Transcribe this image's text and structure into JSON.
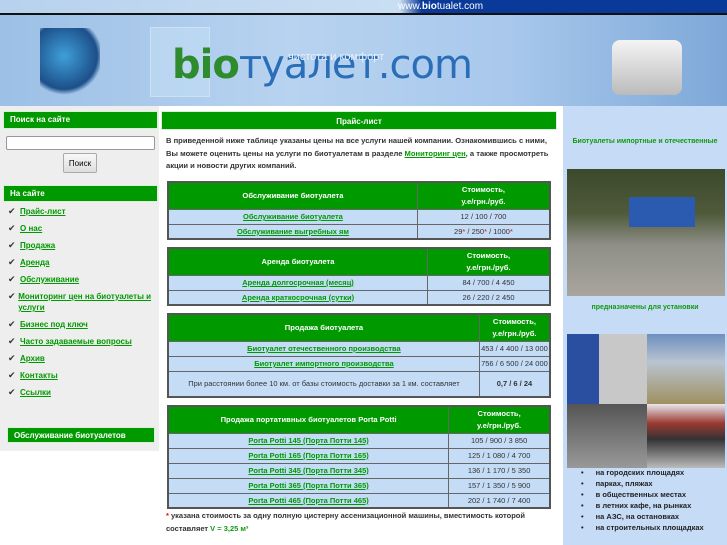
{
  "header": {
    "url_prefix": "www.",
    "url_bold": "bio",
    "url_suffix": "tualet.com",
    "logo_a": "bi",
    "logo_b": "o",
    "logo_c": "туалет.com",
    "slogan": "чистота и комфорт"
  },
  "sidebar": {
    "search_title": "Поиск на сайте",
    "search_value": "",
    "search_button": "Поиск",
    "nav_title": "На сайте",
    "items": [
      "Прайс-лист",
      "О нас",
      "Продажа",
      "Аренда",
      "Обслуживание",
      "Мониторинг цен на биотуалеты и услуги",
      "Бизнес под ключ",
      "Часто задаваемые вопросы",
      "Архив",
      "Контакты",
      "Ссылки"
    ],
    "service_title": "Обслуживание биотуалетов"
  },
  "main": {
    "title": "Прайс-лист",
    "intro_1": "В приведенной ниже таблице указаны цены на все услуги нашей компании. Ознакомившись с ними, Вы можете оценить цены на услуги по биотуалетам в разделе ",
    "intro_link": "Мониторинг цен",
    "intro_2": ", а также просмотреть акции и новости других компаний.",
    "cost_header_1": "Стоимость,",
    "cost_header_2": "у.е/грн./руб.",
    "t1": {
      "title": "Обслуживание биотуалета",
      "rows": [
        {
          "name": "Обслуживание биотуалета",
          "v": "12 / 100 / 700"
        },
        {
          "name": "Обслуживание выгребных ям",
          "v1": "29",
          "v2": "250",
          "v3": "1000"
        }
      ]
    },
    "t2": {
      "title": "Аренда биотуалета",
      "rows": [
        {
          "name": "Аренда долгосрочная (месяц)",
          "v": "84 / 700 / 4 450"
        },
        {
          "name": "Аренда краткосрочная (сутки)",
          "v": "26 / 220 / 2 450"
        }
      ]
    },
    "t3": {
      "title": "Продажа биотуалета",
      "rows": [
        {
          "name": "Биотуалет отечественного производства",
          "v": "453 / 4 400 / 13 000"
        },
        {
          "name": "Биотуалет импортного производства",
          "v": "756 / 6 500 / 24 000"
        },
        {
          "name": "При расстоянии более 10 км. от базы стоимость доставки за 1 км. составляет",
          "v": "0,7 / 6 / 24"
        }
      ]
    },
    "t4": {
      "title": "Продажа портативных биотуалетов Porta Potti",
      "rows": [
        {
          "name": "Porta Potti 145 (Порта Потти 145)",
          "v": "105 / 900 / 3 850"
        },
        {
          "name": "Porta Potti 165 (Порта Потти 165)",
          "v": "125 / 1 080 / 4 700"
        },
        {
          "name": "Porta Potti 345 (Порта Потти 345)",
          "v": "136 / 1 170 / 5 350"
        },
        {
          "name": "Porta Potti 365 (Порта Потти 365)",
          "v": "157 / 1 350 / 5 900"
        },
        {
          "name": "Porta Potti 465 (Порта Потти 465)",
          "v": "202 / 1 740 / 7 400"
        }
      ]
    },
    "footnote_star": "*",
    "footnote": " указана стоимость за одну полную цистерну ассенизационной машины, вместимость которой составляет ",
    "footnote_volume": "V = 3,25 м³"
  },
  "right": {
    "caption_1": "Биотуалеты импортные и отечественные",
    "caption_2": "предназначены для установки",
    "uses": [
      "на городских площадях",
      "парках, пляжах",
      "в общественных местах",
      "в летних кафе, на рынках",
      "на АЗС, на остановках",
      "на строительных площадках"
    ]
  }
}
